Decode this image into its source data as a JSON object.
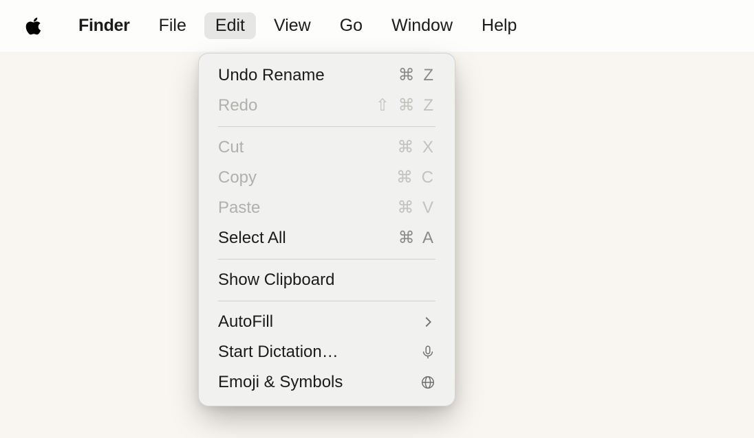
{
  "menubar": {
    "app_name": "Finder",
    "items": [
      {
        "label": "File"
      },
      {
        "label": "Edit"
      },
      {
        "label": "View"
      },
      {
        "label": "Go"
      },
      {
        "label": "Window"
      },
      {
        "label": "Help"
      }
    ],
    "active_item": "Edit"
  },
  "edit_menu": {
    "undo": {
      "label": "Undo Rename",
      "shortcut": "⌘ Z",
      "enabled": true
    },
    "redo": {
      "label": "Redo",
      "shortcut": "⇧ ⌘ Z",
      "enabled": false
    },
    "cut": {
      "label": "Cut",
      "shortcut": "⌘ X",
      "enabled": false
    },
    "copy": {
      "label": "Copy",
      "shortcut": "⌘ C",
      "enabled": false
    },
    "paste": {
      "label": "Paste",
      "shortcut": "⌘ V",
      "enabled": false
    },
    "select_all": {
      "label": "Select All",
      "shortcut": "⌘ A",
      "enabled": true
    },
    "show_clip": {
      "label": "Show Clipboard",
      "enabled": true
    },
    "autofill": {
      "label": "AutoFill",
      "enabled": true,
      "submenu": true
    },
    "dictation": {
      "label": "Start Dictation…",
      "enabled": true,
      "icon": "mic"
    },
    "emoji": {
      "label": "Emoji & Symbols",
      "enabled": true,
      "icon": "globe"
    }
  }
}
